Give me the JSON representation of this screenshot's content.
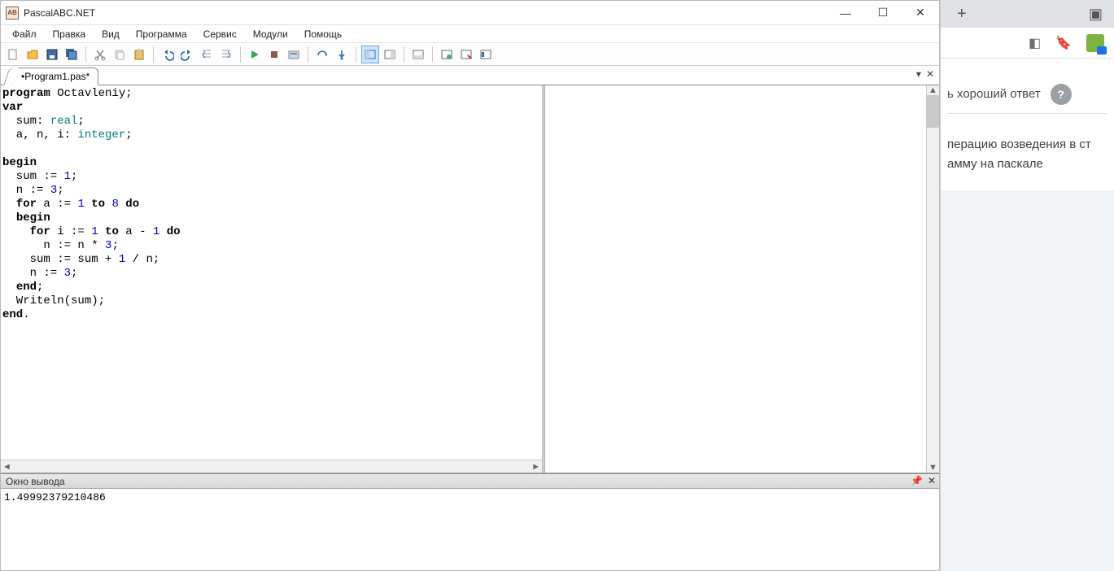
{
  "window": {
    "title": "PascalABC.NET",
    "app_icon_text": "AB"
  },
  "menu": {
    "items": [
      "Файл",
      "Правка",
      "Вид",
      "Программа",
      "Сервис",
      "Модули",
      "Помощь"
    ]
  },
  "toolbar_icons": [
    "new-file-icon",
    "open-file-icon",
    "save-icon",
    "save-all-icon",
    "sep",
    "cut-icon",
    "copy-icon",
    "paste-icon",
    "sep",
    "undo-icon",
    "redo-icon",
    "indent-left-icon",
    "indent-right-icon",
    "sep",
    "run-icon",
    "stop-icon",
    "compile-icon",
    "sep",
    "step-over-icon",
    "step-into-icon",
    "sep",
    "layout-a-icon",
    "layout-b-icon",
    "sep",
    "layout-c-icon",
    "sep",
    "window-a-icon",
    "window-b-icon",
    "window-c-icon"
  ],
  "tabs": {
    "active": "•Program1.pas*"
  },
  "code": {
    "lines": [
      {
        "t": [
          [
            "kw",
            "program"
          ],
          [
            "_",
            " Octavleniy;"
          ]
        ]
      },
      {
        "t": [
          [
            "kw",
            "var"
          ]
        ]
      },
      {
        "t": [
          [
            "_",
            "  sum: "
          ],
          [
            "typ",
            "real"
          ],
          [
            "_",
            ";"
          ]
        ]
      },
      {
        "t": [
          [
            "_",
            "  a, n, i: "
          ],
          [
            "typ",
            "integer"
          ],
          [
            "_",
            ";"
          ]
        ]
      },
      {
        "t": [
          [
            "_",
            ""
          ]
        ]
      },
      {
        "t": [
          [
            "kw",
            "begin"
          ]
        ]
      },
      {
        "t": [
          [
            "_",
            "  sum := "
          ],
          [
            "num",
            "1"
          ],
          [
            "_",
            ";"
          ]
        ]
      },
      {
        "t": [
          [
            "_",
            "  n := "
          ],
          [
            "num",
            "3"
          ],
          [
            "_",
            ";"
          ]
        ]
      },
      {
        "t": [
          [
            "_",
            "  "
          ],
          [
            "kw",
            "for"
          ],
          [
            "_",
            " a := "
          ],
          [
            "num",
            "1"
          ],
          [
            "_",
            " "
          ],
          [
            "kw",
            "to"
          ],
          [
            "_",
            " "
          ],
          [
            "num",
            "8"
          ],
          [
            "_",
            " "
          ],
          [
            "kw",
            "do"
          ]
        ]
      },
      {
        "t": [
          [
            "_",
            "  "
          ],
          [
            "kw",
            "begin"
          ]
        ]
      },
      {
        "t": [
          [
            "_",
            "    "
          ],
          [
            "kw",
            "for"
          ],
          [
            "_",
            " i := "
          ],
          [
            "num",
            "1"
          ],
          [
            "_",
            " "
          ],
          [
            "kw",
            "to"
          ],
          [
            "_",
            " a - "
          ],
          [
            "num",
            "1"
          ],
          [
            "_",
            " "
          ],
          [
            "kw",
            "do"
          ]
        ]
      },
      {
        "t": [
          [
            "_",
            "      n := n * "
          ],
          [
            "num",
            "3"
          ],
          [
            "_",
            ";"
          ]
        ]
      },
      {
        "t": [
          [
            "_",
            "    sum := sum + "
          ],
          [
            "num",
            "1"
          ],
          [
            "_",
            " / n;"
          ]
        ]
      },
      {
        "t": [
          [
            "_",
            "    n := "
          ],
          [
            "num",
            "3"
          ],
          [
            "_",
            ";"
          ]
        ]
      },
      {
        "t": [
          [
            "_",
            "  "
          ],
          [
            "kw",
            "end"
          ],
          [
            "_",
            ";"
          ]
        ]
      },
      {
        "t": [
          [
            "_",
            "  Writeln(sum);"
          ]
        ]
      },
      {
        "t": [
          [
            "kw",
            "end"
          ],
          [
            "_",
            "."
          ]
        ]
      }
    ]
  },
  "output_panel": {
    "title": "Окно вывода",
    "text": "1.49992379210486"
  },
  "browser": {
    "header_text": "ь хороший ответ",
    "body_line1": "перацию возведения в ст",
    "body_line2": "амму на паскале"
  }
}
